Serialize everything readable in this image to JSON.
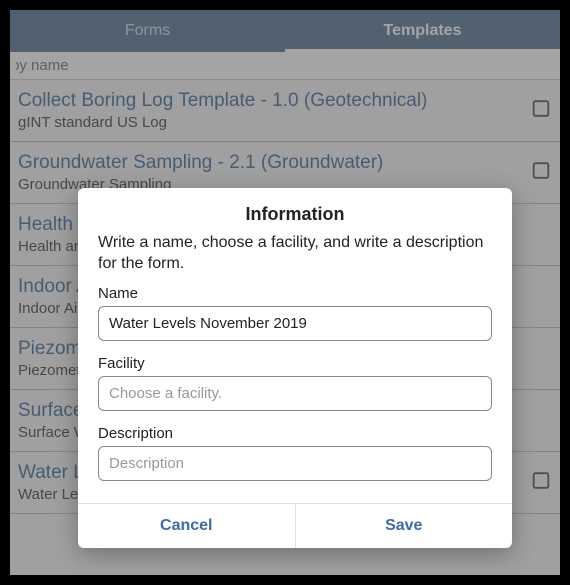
{
  "tabs": {
    "forms": "Forms",
    "templates": "Templates"
  },
  "search": {
    "placeholder": "Search by name",
    "visible_text": "rch by name"
  },
  "items": [
    {
      "title": "Collect Boring Log Template - 1.0 (Geotechnical)",
      "sub": "gINT standard US Log"
    },
    {
      "title": "Groundwater Sampling - 2.1 (Groundwater)",
      "sub": "Groundwater Sampling"
    },
    {
      "title": "Health and",
      "sub": "Health and"
    },
    {
      "title": "Indoor Air",
      "sub": "Indoor Air"
    },
    {
      "title": "Piezometer",
      "sub": "Piezometer"
    },
    {
      "title": "Surface Water",
      "sub": "Surface Water"
    },
    {
      "title": "Water Levels",
      "sub": "Water Levels"
    }
  ],
  "dialog": {
    "title": "Information",
    "text": "Write a name, choose a facility, and write a description for the form.",
    "name_label": "Name",
    "name_value": "Water Levels November 2019",
    "facility_label": "Facility",
    "facility_placeholder": "Choose a facility.",
    "description_label": "Description",
    "description_placeholder": "Description",
    "cancel": "Cancel",
    "save": "Save"
  },
  "colors": {
    "header": "#4a6a8c",
    "link": "#2f5f93",
    "action": "#3b6ca8"
  }
}
